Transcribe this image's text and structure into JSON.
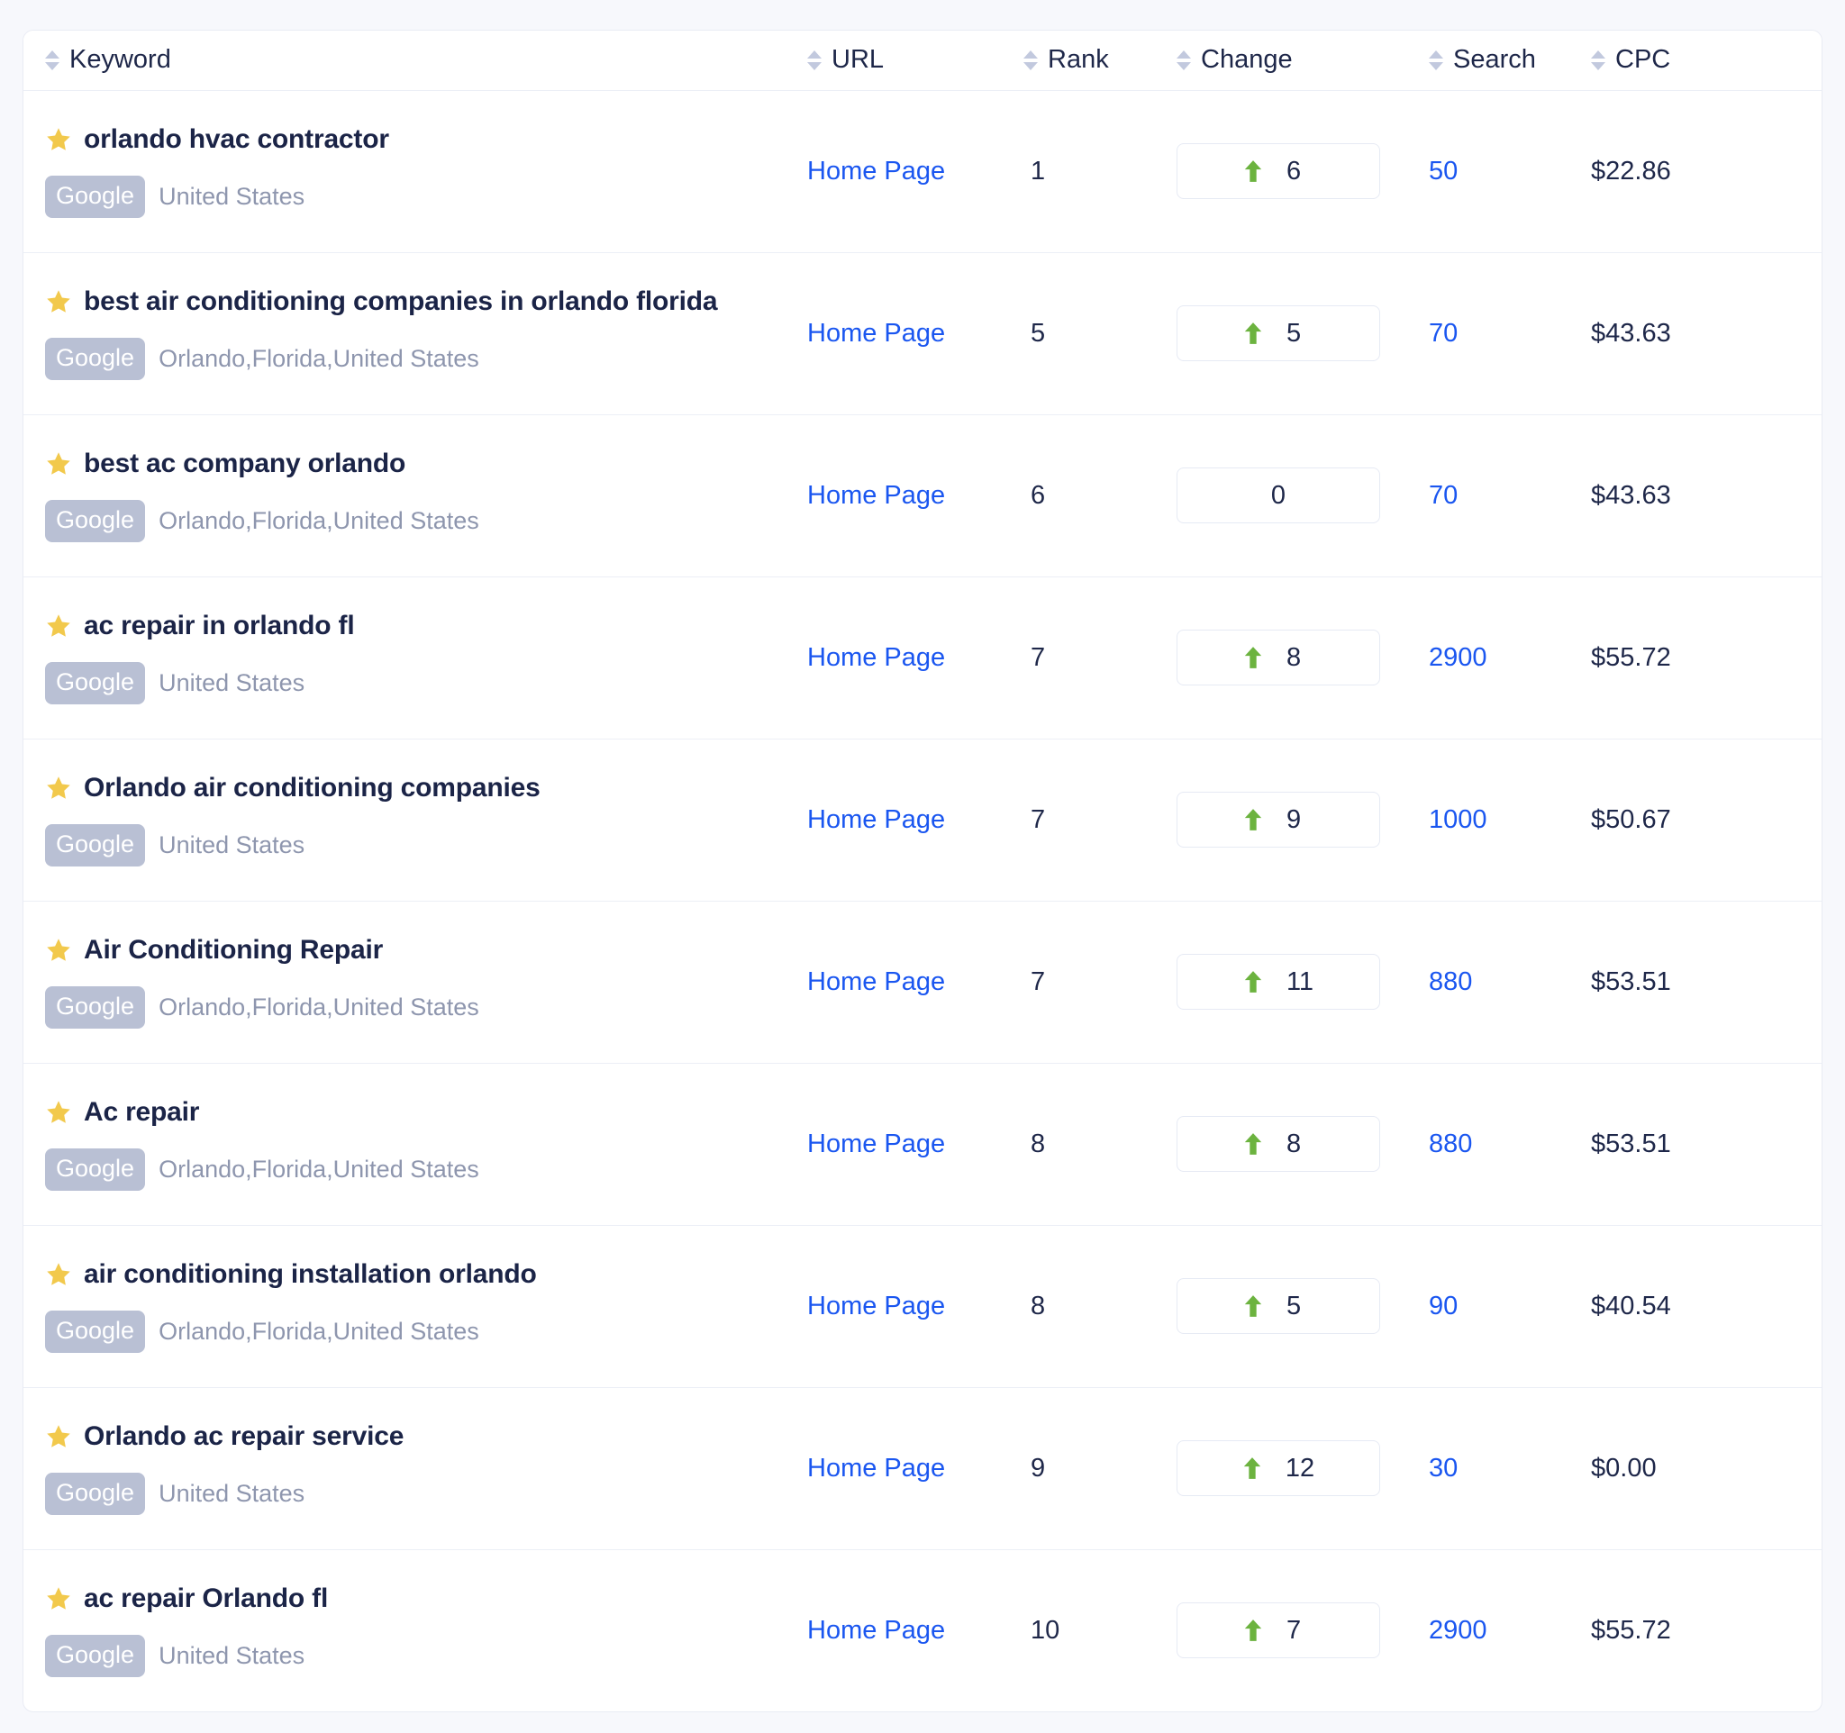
{
  "colors": {
    "page_background": "#f7f8fc",
    "card_background": "#ffffff",
    "border": "#eceff6",
    "text_primary": "#1e2749",
    "link_blue": "#1a56f0",
    "muted_text": "#8e96ae",
    "badge_gray": "#b9c0d4",
    "star_yellow": "#f2c94c",
    "arrow_green": "#6cb33f",
    "sort_arrow": "#c2c9de"
  },
  "table": {
    "columns": [
      {
        "key": "keyword",
        "label": "Keyword",
        "sortable": true,
        "sort_icon": "sort-updown-icon"
      },
      {
        "key": "url",
        "label": "URL",
        "sortable": true,
        "sort_icon": "sort-updown-icon"
      },
      {
        "key": "rank",
        "label": "Rank",
        "sortable": true,
        "sort_icon": "sort-updown-icon"
      },
      {
        "key": "change",
        "label": "Change",
        "sortable": true,
        "sort_icon": "sort-updown-icon"
      },
      {
        "key": "search",
        "label": "Search",
        "sortable": true,
        "sort_icon": "sort-updown-icon"
      },
      {
        "key": "cpc",
        "label": "CPC",
        "sortable": true,
        "sort_icon": "sort-updown-icon"
      }
    ],
    "rows": [
      {
        "starred": true,
        "star_icon": "star-icon",
        "keyword": "orlando hvac contractor",
        "engine": "Google",
        "location": "United States",
        "url": "Home Page",
        "rank": "1",
        "change": "6",
        "change_direction": "up",
        "search": "50",
        "cpc": "$22.86"
      },
      {
        "starred": true,
        "star_icon": "star-icon",
        "keyword": "best air conditioning companies in orlando florida",
        "engine": "Google",
        "location": "Orlando,Florida,United States",
        "url": "Home Page",
        "rank": "5",
        "change": "5",
        "change_direction": "up",
        "search": "70",
        "cpc": "$43.63"
      },
      {
        "starred": true,
        "star_icon": "star-icon",
        "keyword": "best ac company orlando",
        "engine": "Google",
        "location": "Orlando,Florida,United States",
        "url": "Home Page",
        "rank": "6",
        "change": "0",
        "change_direction": "none",
        "search": "70",
        "cpc": "$43.63"
      },
      {
        "starred": true,
        "star_icon": "star-icon",
        "keyword": "ac repair in orlando fl",
        "engine": "Google",
        "location": "United States",
        "url": "Home Page",
        "rank": "7",
        "change": "8",
        "change_direction": "up",
        "search": "2900",
        "cpc": "$55.72"
      },
      {
        "starred": true,
        "star_icon": "star-icon",
        "keyword": "Orlando air conditioning companies",
        "engine": "Google",
        "location": "United States",
        "url": "Home Page",
        "rank": "7",
        "change": "9",
        "change_direction": "up",
        "search": "1000",
        "cpc": "$50.67"
      },
      {
        "starred": true,
        "star_icon": "star-icon",
        "keyword": "Air Conditioning Repair",
        "engine": "Google",
        "location": "Orlando,Florida,United States",
        "url": "Home Page",
        "rank": "7",
        "change": "11",
        "change_direction": "up",
        "search": "880",
        "cpc": "$53.51"
      },
      {
        "starred": true,
        "star_icon": "star-icon",
        "keyword": "Ac repair",
        "engine": "Google",
        "location": "Orlando,Florida,United States",
        "url": "Home Page",
        "rank": "8",
        "change": "8",
        "change_direction": "up",
        "search": "880",
        "cpc": "$53.51"
      },
      {
        "starred": true,
        "star_icon": "star-icon",
        "keyword": "air conditioning installation orlando",
        "engine": "Google",
        "location": "Orlando,Florida,United States",
        "url": "Home Page",
        "rank": "8",
        "change": "5",
        "change_direction": "up",
        "search": "90",
        "cpc": "$40.54"
      },
      {
        "starred": true,
        "star_icon": "star-icon",
        "keyword": "Orlando ac repair service",
        "engine": "Google",
        "location": "United States",
        "url": "Home Page",
        "rank": "9",
        "change": "12",
        "change_direction": "up",
        "search": "30",
        "cpc": "$0.00"
      },
      {
        "starred": true,
        "star_icon": "star-icon",
        "keyword": "ac repair Orlando fl",
        "engine": "Google",
        "location": "United States",
        "url": "Home Page",
        "rank": "10",
        "change": "7",
        "change_direction": "up",
        "search": "2900",
        "cpc": "$55.72"
      }
    ]
  }
}
